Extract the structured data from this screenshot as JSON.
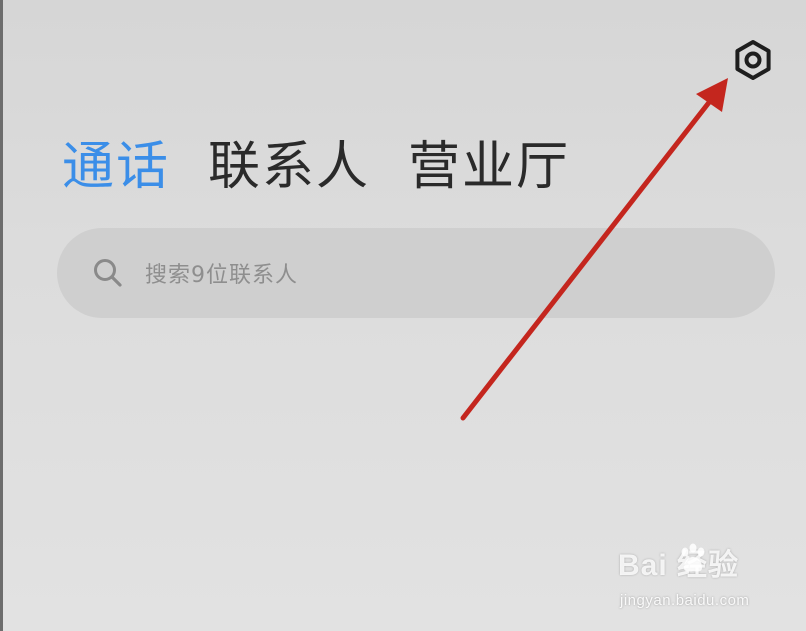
{
  "header": {
    "settings_icon": "settings-hexagon-icon"
  },
  "tabs": [
    {
      "label": "通话",
      "active": true
    },
    {
      "label": "联系人",
      "active": false
    },
    {
      "label": "营业厅",
      "active": false
    }
  ],
  "search": {
    "placeholder": "搜索9位联系人",
    "icon": "search-icon"
  },
  "colors": {
    "accent": "#3b8ee8",
    "arrow": "#c4261e",
    "background": "#dcdcdc"
  },
  "watermark": {
    "brand": "Bai 经验",
    "url": "jingyan.baidu.com"
  }
}
